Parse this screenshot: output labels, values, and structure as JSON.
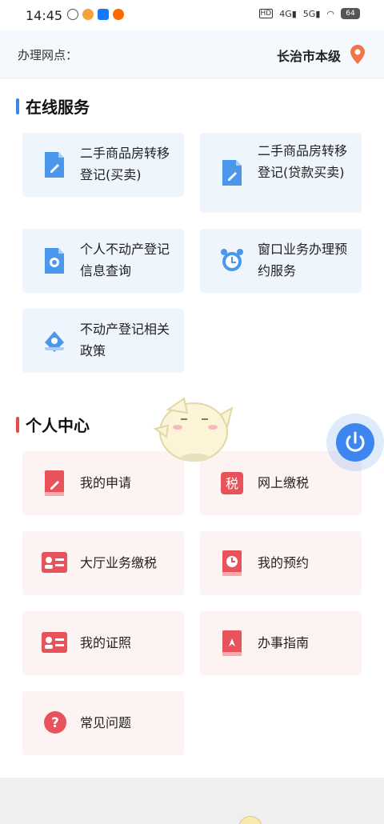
{
  "status_bar": {
    "time": "14:45",
    "battery": "64",
    "net1": "4G",
    "net2": "5G",
    "hd": "HD"
  },
  "location": {
    "label": "办理网点：",
    "value": "长治市本级",
    "pin_color": "#f0764a"
  },
  "online_services": {
    "title": "在线服务",
    "accent": "#3b87e8",
    "items": [
      {
        "label": "二手商品房转移登记(买卖)",
        "icon": "document-icon"
      },
      {
        "label": "二手商品房转移登记(贷款买卖)",
        "icon": "document-icon"
      },
      {
        "label": "个人不动产登记信息查询",
        "icon": "file-search-icon"
      },
      {
        "label": "窗口业务办理预约服务",
        "icon": "alarm-clock-icon"
      },
      {
        "label": "不动产登记相关政策",
        "icon": "policy-icon"
      }
    ]
  },
  "personal_center": {
    "title": "个人中心",
    "accent": "#e84a4a",
    "items": [
      {
        "label": "我的申请",
        "icon": "application-book-icon"
      },
      {
        "label": "网上缴税",
        "icon": "tax-icon",
        "icon_text": "税"
      },
      {
        "label": "大厅业务缴税",
        "icon": "id-card-icon"
      },
      {
        "label": "我的预约",
        "icon": "clock-book-icon"
      },
      {
        "label": "我的证照",
        "icon": "id-card-icon"
      },
      {
        "label": "办事指南",
        "icon": "guide-book-icon"
      },
      {
        "label": "常见问题",
        "icon": "question-icon",
        "icon_text": "?"
      }
    ]
  },
  "float_button": {
    "icon": "power-icon",
    "color": "#3d86ef"
  }
}
